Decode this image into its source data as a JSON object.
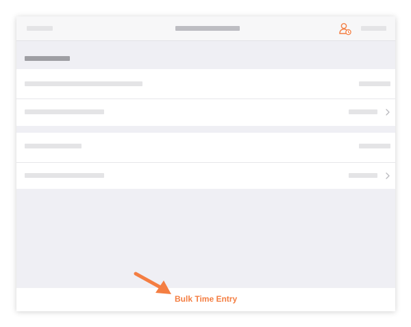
{
  "footer": {
    "action_label": "Bulk Time Entry"
  },
  "icons": {
    "user": "user-clock-icon",
    "chevron": "chevron-right-icon",
    "arrow": "callout-arrow-icon"
  },
  "colors": {
    "accent": "#f47e42",
    "background": "#efeff4",
    "placeholder": "#e4e4e6"
  }
}
